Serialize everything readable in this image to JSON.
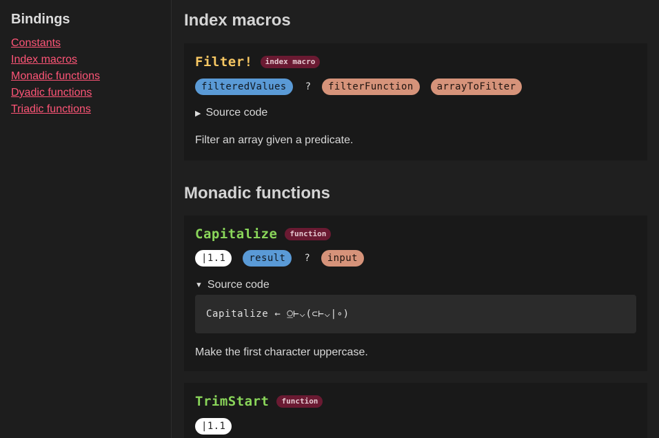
{
  "sidebar": {
    "title": "Bindings",
    "links": [
      "Constants",
      "Index macros",
      "Monadic functions",
      "Dyadic functions",
      "Triadic functions"
    ]
  },
  "sections": {
    "index_macros": {
      "title": "Index macros",
      "filter": {
        "name": "Filter!",
        "kind": "index macro",
        "output": "filteredValues",
        "separator": "?",
        "inputs": [
          "filterFunction",
          "arrayToFilter"
        ],
        "source_label": "Source code",
        "description": "Filter an array given a predicate."
      }
    },
    "monadic": {
      "title": "Monadic functions",
      "capitalize": {
        "name": "Capitalize",
        "kind": "function",
        "version": "|1.1",
        "output": "result",
        "separator": "?",
        "input": "input",
        "source_label": "Source code",
        "code": "Capitalize ← ⍜⊢⌵(⊂⊢⌵|∘)",
        "description": "Make the first character uppercase."
      },
      "trimstart": {
        "name": "TrimStart",
        "kind": "function",
        "version": "|1.1"
      }
    }
  },
  "colors": {
    "link": "#ff5577",
    "macro_name": "#f7c763",
    "function_name": "#8ad65a",
    "output_pill": "#5a9ad6",
    "input_pill": "#d6937a",
    "kind_badge": "#6a1a32"
  }
}
